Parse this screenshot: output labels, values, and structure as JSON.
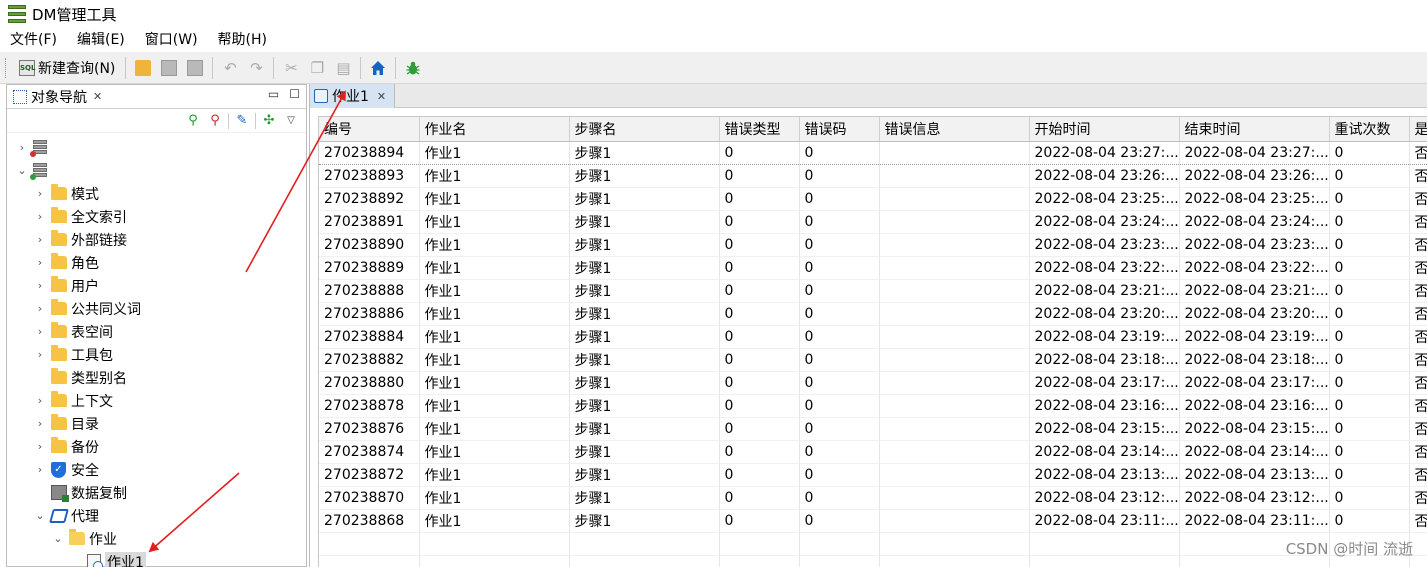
{
  "window": {
    "title": "DM管理工具"
  },
  "menubar": [
    "文件(F)",
    "编辑(E)",
    "窗口(W)",
    "帮助(H)"
  ],
  "toolbar": {
    "new_query_label": "新建查询(N)"
  },
  "left_panel": {
    "tab_label": "对象导航",
    "tree": [
      {
        "label": "",
        "level": 0,
        "icon": "db-server-red-icon",
        "chevron": "right"
      },
      {
        "label": "",
        "level": 0,
        "icon": "db-server-green-icon",
        "chevron": "down"
      },
      {
        "label": "模式",
        "level": 1,
        "icon": "folder-icon",
        "chevron": "right"
      },
      {
        "label": "全文索引",
        "level": 1,
        "icon": "folder-icon",
        "chevron": "right"
      },
      {
        "label": "外部链接",
        "level": 1,
        "icon": "folder-icon",
        "chevron": "right"
      },
      {
        "label": "角色",
        "level": 1,
        "icon": "folder-icon",
        "chevron": "right"
      },
      {
        "label": "用户",
        "level": 1,
        "icon": "folder-icon",
        "chevron": "right"
      },
      {
        "label": "公共同义词",
        "level": 1,
        "icon": "folder-icon",
        "chevron": "right"
      },
      {
        "label": "表空间",
        "level": 1,
        "icon": "folder-icon",
        "chevron": "right"
      },
      {
        "label": "工具包",
        "level": 1,
        "icon": "folder-icon",
        "chevron": "right"
      },
      {
        "label": "类型别名",
        "level": 1,
        "icon": "folder-icon",
        "chevron": "none"
      },
      {
        "label": "上下文",
        "level": 1,
        "icon": "folder-icon",
        "chevron": "right"
      },
      {
        "label": "目录",
        "level": 1,
        "icon": "folder-icon",
        "chevron": "right"
      },
      {
        "label": "备份",
        "level": 1,
        "icon": "folder-icon",
        "chevron": "right"
      },
      {
        "label": "安全",
        "level": 1,
        "icon": "shield-icon",
        "chevron": "right"
      },
      {
        "label": "数据复制",
        "level": 1,
        "icon": "replication-icon",
        "chevron": "none"
      },
      {
        "label": "代理",
        "level": 1,
        "icon": "agent-icon",
        "chevron": "down"
      },
      {
        "label": "作业",
        "level": 2,
        "icon": "folder-open-icon",
        "chevron": "down"
      },
      {
        "label": "作业1",
        "level": 3,
        "icon": "job-icon",
        "chevron": "none",
        "selected": true
      }
    ]
  },
  "editor_tab": {
    "label": "作业1"
  },
  "table": {
    "columns": [
      "编号",
      "作业名",
      "步骤名",
      "错误类型",
      "错误码",
      "错误信息",
      "开始时间",
      "结束时间",
      "重试次数",
      "是"
    ],
    "rows": [
      [
        "270238894",
        "作业1",
        "步骤1",
        "0",
        "0",
        "",
        "2022-08-04 23:27:...",
        "2022-08-04 23:27:...",
        "0",
        "否"
      ],
      [
        "270238893",
        "作业1",
        "步骤1",
        "0",
        "0",
        "",
        "2022-08-04 23:26:...",
        "2022-08-04 23:26:...",
        "0",
        "否"
      ],
      [
        "270238892",
        "作业1",
        "步骤1",
        "0",
        "0",
        "",
        "2022-08-04 23:25:...",
        "2022-08-04 23:25:...",
        "0",
        "否"
      ],
      [
        "270238891",
        "作业1",
        "步骤1",
        "0",
        "0",
        "",
        "2022-08-04 23:24:...",
        "2022-08-04 23:24:...",
        "0",
        "否"
      ],
      [
        "270238890",
        "作业1",
        "步骤1",
        "0",
        "0",
        "",
        "2022-08-04 23:23:...",
        "2022-08-04 23:23:...",
        "0",
        "否"
      ],
      [
        "270238889",
        "作业1",
        "步骤1",
        "0",
        "0",
        "",
        "2022-08-04 23:22:...",
        "2022-08-04 23:22:...",
        "0",
        "否"
      ],
      [
        "270238888",
        "作业1",
        "步骤1",
        "0",
        "0",
        "",
        "2022-08-04 23:21:...",
        "2022-08-04 23:21:...",
        "0",
        "否"
      ],
      [
        "270238886",
        "作业1",
        "步骤1",
        "0",
        "0",
        "",
        "2022-08-04 23:20:...",
        "2022-08-04 23:20:...",
        "0",
        "否"
      ],
      [
        "270238884",
        "作业1",
        "步骤1",
        "0",
        "0",
        "",
        "2022-08-04 23:19:...",
        "2022-08-04 23:19:...",
        "0",
        "否"
      ],
      [
        "270238882",
        "作业1",
        "步骤1",
        "0",
        "0",
        "",
        "2022-08-04 23:18:...",
        "2022-08-04 23:18:...",
        "0",
        "否"
      ],
      [
        "270238880",
        "作业1",
        "步骤1",
        "0",
        "0",
        "",
        "2022-08-04 23:17:...",
        "2022-08-04 23:17:...",
        "0",
        "否"
      ],
      [
        "270238878",
        "作业1",
        "步骤1",
        "0",
        "0",
        "",
        "2022-08-04 23:16:...",
        "2022-08-04 23:16:...",
        "0",
        "否"
      ],
      [
        "270238876",
        "作业1",
        "步骤1",
        "0",
        "0",
        "",
        "2022-08-04 23:15:...",
        "2022-08-04 23:15:...",
        "0",
        "否"
      ],
      [
        "270238874",
        "作业1",
        "步骤1",
        "0",
        "0",
        "",
        "2022-08-04 23:14:...",
        "2022-08-04 23:14:...",
        "0",
        "否"
      ],
      [
        "270238872",
        "作业1",
        "步骤1",
        "0",
        "0",
        "",
        "2022-08-04 23:13:...",
        "2022-08-04 23:13:...",
        "0",
        "否"
      ],
      [
        "270238870",
        "作业1",
        "步骤1",
        "0",
        "0",
        "",
        "2022-08-04 23:12:...",
        "2022-08-04 23:12:...",
        "0",
        "否"
      ],
      [
        "270238868",
        "作业1",
        "步骤1",
        "0",
        "0",
        "",
        "2022-08-04 23:11:...",
        "2022-08-04 23:11:...",
        "0",
        "否"
      ]
    ]
  },
  "watermark": "CSDN @时间 流逝",
  "colors": {
    "annotation_arrow": "#e41e1e",
    "tab_active": "#d5e3f2",
    "folder": "#f6c344"
  }
}
